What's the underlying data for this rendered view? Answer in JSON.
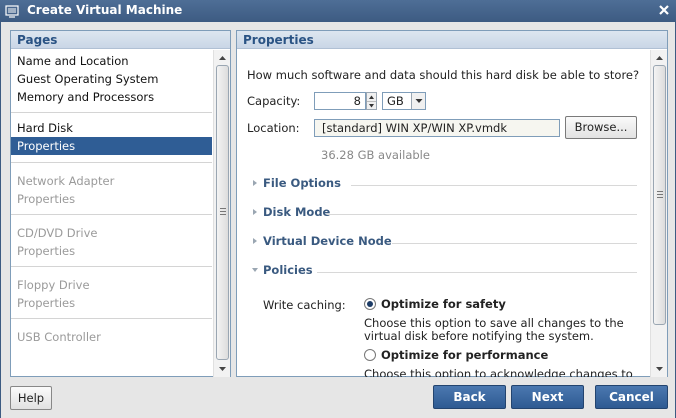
{
  "window": {
    "title": "Create Virtual Machine"
  },
  "pages_panel": {
    "header": "Pages",
    "groups": [
      {
        "items": [
          {
            "label": "Name and Location"
          },
          {
            "label": "Guest Operating System"
          },
          {
            "label": "Memory and Processors"
          }
        ]
      },
      {
        "items": [
          {
            "label": "Hard Disk"
          },
          {
            "label": "Properties"
          }
        ]
      },
      {
        "items": [
          {
            "label": "Network Adapter"
          },
          {
            "label": "Properties"
          }
        ]
      },
      {
        "items": [
          {
            "label": "CD/DVD Drive"
          },
          {
            "label": "Properties"
          }
        ]
      },
      {
        "items": [
          {
            "label": "Floppy Drive"
          },
          {
            "label": "Properties"
          }
        ]
      },
      {
        "items": [
          {
            "label": "USB Controller"
          }
        ]
      }
    ]
  },
  "properties_panel": {
    "header": "Properties",
    "question": "How much software and data should this hard disk be able to store?",
    "capacity_label": "Capacity:",
    "capacity_value": "8",
    "capacity_unit": "GB",
    "location_label": "Location:",
    "location_value": "[standard] WIN XP/WIN XP.vmdk",
    "browse_label": "Browse...",
    "available": "36.28 GB available",
    "sections": [
      {
        "label": "File Options",
        "expanded": false
      },
      {
        "label": "Disk Mode",
        "expanded": false
      },
      {
        "label": "Virtual Device Node",
        "expanded": false
      },
      {
        "label": "Policies",
        "expanded": true
      }
    ],
    "write_caching_label": "Write caching:",
    "options": [
      {
        "label": "Optimize for safety",
        "selected": true,
        "desc_line1": "Choose this option to save all changes to the",
        "desc_line2": "virtual disk before notifying the system."
      },
      {
        "label": "Optimize for performance",
        "selected": false,
        "desc_line1": "Choose this option to acknowledge changes to",
        "desc_line2": ""
      }
    ]
  },
  "buttons": {
    "help": "Help",
    "back": "Back",
    "next": "Next",
    "cancel": "Cancel"
  },
  "colors": {
    "title_bar": "#3d5b82",
    "selection": "#2f5d95",
    "section_text": "#3a5a80",
    "primary_button": "#3a67a0"
  }
}
